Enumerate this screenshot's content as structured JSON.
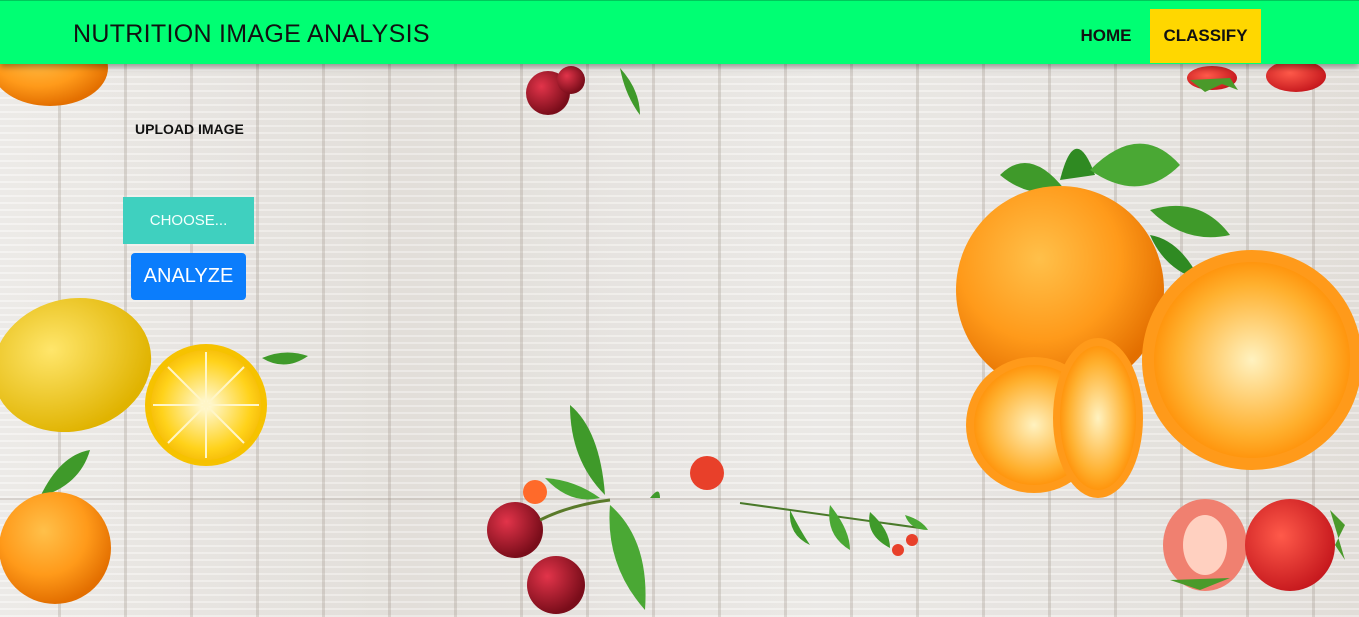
{
  "navbar": {
    "brand": "NUTRITION IMAGE ANALYSIS",
    "home_label": "HOME",
    "classify_label": "CLASSIFY",
    "bg_color": "#00ff73",
    "classify_color": "#ffd700"
  },
  "upload": {
    "label": "UPLOAD IMAGE",
    "choose_label": "CHOOSE...",
    "analyze_label": "ANALYZE",
    "choose_color": "#3fd0bf",
    "analyze_color": "#0b7dfc"
  },
  "background": {
    "theme": "wooden planks with fruit illustrations",
    "icons": [
      "orange-icon",
      "lemon-icon",
      "cherry-icon",
      "strawberry-icon",
      "leaf-icon"
    ]
  }
}
